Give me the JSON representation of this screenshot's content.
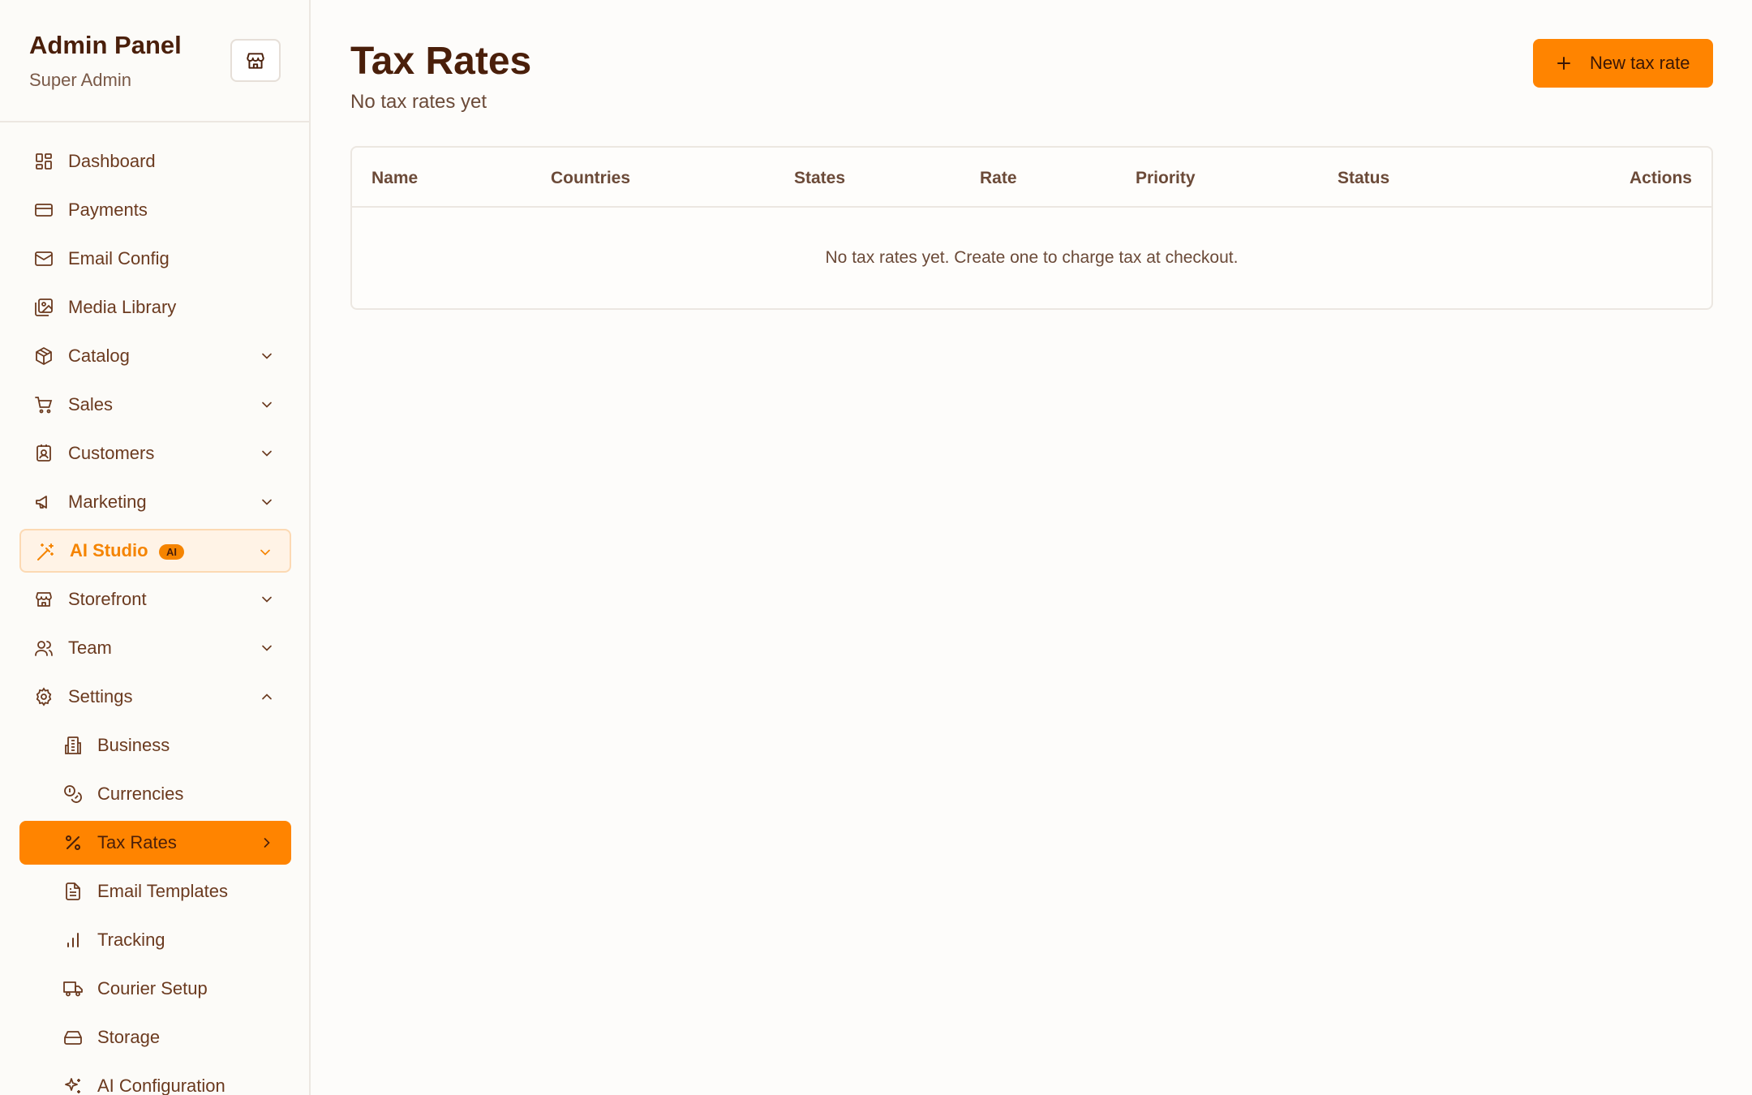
{
  "sidebar": {
    "title": "Admin Panel",
    "subtitle": "Super Admin",
    "items": [
      {
        "label": "Dashboard"
      },
      {
        "label": "Payments"
      },
      {
        "label": "Email Config"
      },
      {
        "label": "Media Library"
      },
      {
        "label": "Catalog"
      },
      {
        "label": "Sales"
      },
      {
        "label": "Customers"
      },
      {
        "label": "Marketing"
      },
      {
        "label": "AI Studio",
        "badge": "AI"
      },
      {
        "label": "Storefront"
      },
      {
        "label": "Team"
      },
      {
        "label": "Settings"
      },
      {
        "label": "Business"
      },
      {
        "label": "Currencies"
      },
      {
        "label": "Tax Rates"
      },
      {
        "label": "Email Templates"
      },
      {
        "label": "Tracking"
      },
      {
        "label": "Courier Setup"
      },
      {
        "label": "Storage"
      },
      {
        "label": "AI Configuration"
      }
    ]
  },
  "main": {
    "title": "Tax Rates",
    "subtitle": "No tax rates yet",
    "new_button": "New tax rate",
    "table": {
      "columns": [
        "Name",
        "Countries",
        "States",
        "Rate",
        "Priority",
        "Status",
        "Actions"
      ],
      "empty_message": "No tax rates yet. Create one to charge tax at checkout."
    }
  },
  "colors": {
    "accent": "#ff8400",
    "text_dark": "#4a1f0a",
    "background": "#fdfcfa"
  }
}
